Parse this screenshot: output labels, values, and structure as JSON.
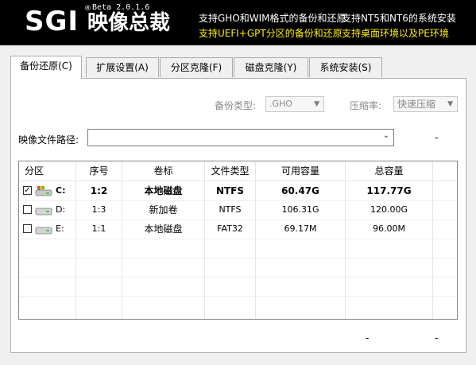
{
  "header": {
    "logo_text": "SGI",
    "logo_reg": "®",
    "logo_cn": "映像总裁",
    "version": "Beta 2.0.1.6",
    "features": [
      "支持GHO和WIM格式的备份和还原",
      "支持NT5和NT6的系统安装",
      "支持UEFI+GPT分区的备份和还原",
      "支持桌面环境以及PE环境"
    ]
  },
  "tabs": [
    {
      "label": "备份还原(C)",
      "active": true
    },
    {
      "label": "扩展设置(A)",
      "active": false
    },
    {
      "label": "分区克隆(F)",
      "active": false
    },
    {
      "label": "磁盘克隆(Y)",
      "active": false
    },
    {
      "label": "系统安装(S)",
      "active": false
    }
  ],
  "form": {
    "backup_type_label": "备份类型:",
    "backup_type_value": ".GHO",
    "compress_label": "压缩率:",
    "compress_value": "快速压缩",
    "image_path_label": "映像文件路径:",
    "image_path_value": "",
    "side_dash": "-"
  },
  "table": {
    "headers": [
      "分区",
      "序号",
      "卷标",
      "文件类型",
      "可用容量",
      "总容量"
    ],
    "rows": [
      {
        "checked": true,
        "drive": "C:",
        "index": "1:2",
        "label": "本地磁盘",
        "fs": "NTFS",
        "free": "60.47G",
        "total": "117.77G",
        "system": true
      },
      {
        "checked": false,
        "drive": "D:",
        "index": "1:3",
        "label": "新加卷",
        "fs": "NTFS",
        "free": "106.31G",
        "total": "120.00G",
        "system": false
      },
      {
        "checked": false,
        "drive": "E:",
        "index": "1:1",
        "label": "本地磁盘",
        "fs": "FAT32",
        "free": "69.17M",
        "total": "96.00M",
        "system": false
      }
    ]
  },
  "footer": {
    "dash_left": "-",
    "dash_right": "-"
  },
  "colors": {
    "banner_bg": "#000000",
    "highlight_text": "#ffee00"
  }
}
